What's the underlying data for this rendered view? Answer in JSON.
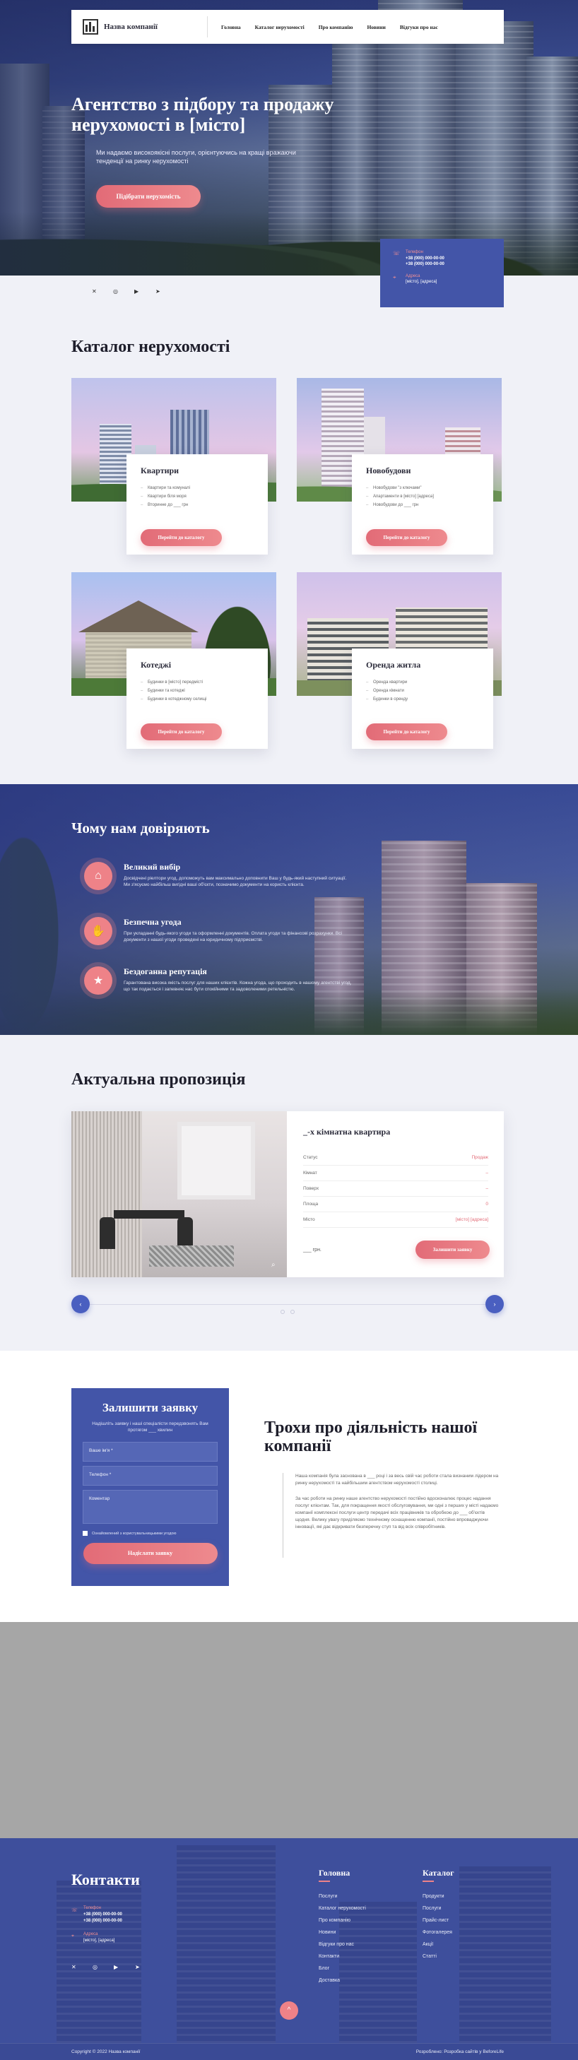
{
  "nav": {
    "brand": "Назва компанії",
    "items": [
      "Головна",
      "Каталог нерухомості",
      "Про компанію",
      "Новини",
      "Відгуки про нас"
    ]
  },
  "hero": {
    "title": "Агентство з підбору та продажу нерухомості в [місто]",
    "subtitle": "Ми надаємо високоякісні послуги, орієнтуючись на кращі вражаючи тенденції на ринку нерухомості",
    "button": "Підібрати нерухомість",
    "phone_label": "Телефон",
    "phone1": "+38 (000) 000-00-00",
    "phone2": "+38 (000) 000-00-00",
    "address_label": "Адреса",
    "address": "[місто], [адреса]"
  },
  "catalog": {
    "title": "Каталог нерухомості",
    "cards": [
      {
        "title": "Квартири",
        "items": [
          "Квартири та комуналі",
          "Квартири біля моря",
          "Вторинне до ___ грн"
        ],
        "button": "Перейти до каталогу"
      },
      {
        "title": "Новобудови",
        "items": [
          "Новобудови \"з ключами\"",
          "Апартаменти в [місто] [адреса]",
          "Новобудови до ___ грн"
        ],
        "button": "Перейти до каталогу"
      },
      {
        "title": "Котеджі",
        "items": [
          "Будинки в [місто] передмісті",
          "Будинки та котеджі",
          "Будинки в котеджному селищі"
        ],
        "button": "Перейти до каталогу"
      },
      {
        "title": "Оренда житла",
        "items": [
          "Оренда квартири",
          "Оренда кімнати",
          "Будинки в оренду"
        ],
        "button": "Перейти до каталогу"
      }
    ]
  },
  "trust": {
    "title": "Чому нам довіряють",
    "items": [
      {
        "icon": "home-icon",
        "title": "Великий вибір",
        "text": "Досвідчені ріелтори угод, допоможуть вам максимально доповнити Ваш у будь-який наступний ситуації. Ми з'ясуємо найбільш вигідні ваші об'єкти, позначимо документи на користь клієнта."
      },
      {
        "icon": "handshake-icon",
        "title": "Безпечна угода",
        "text": "При укладанні будь-якого угоди та оформленні документів. Оплата угоди та фінансові розрахунки. Всі документи з нашої угоди проведені на юридичному підприємстві."
      },
      {
        "icon": "star-icon",
        "title": "Бездоганна репутація",
        "text": "Гарантована висока якість послуг для наших клієнтів. Кожна угода, що проходить в нашому агентстві угод, що так подається і запевняє нас бути спокійними та задоволеними ретельністю."
      }
    ]
  },
  "offer": {
    "title": "Актуальна пропозиція",
    "heading": "_-х кімнатна квартира",
    "rows": [
      {
        "label": "Статус",
        "value": "Продаж"
      },
      {
        "label": "Кімнат",
        "value": "–"
      },
      {
        "label": "Поверх",
        "value": "–"
      },
      {
        "label": "Площа",
        "value": "0"
      },
      {
        "label": "Місто",
        "value": "[місто] [адреса]"
      }
    ],
    "price": "___ грн.",
    "button": "Залишити заявку"
  },
  "form": {
    "title": "Залишити заявку",
    "subtitle": "Надішліть заявку і наші спеціалісти передзвонять Вам протягом ___ хвилин",
    "name_placeholder": "Ваше ім'я *",
    "phone_placeholder": "Телефон *",
    "comment_placeholder": "Коментар",
    "consent": "Ознайомлений з користувальницькими угодою",
    "button": "Надіслати заявку"
  },
  "about": {
    "title": "Трохи про діяльність нашої компанії",
    "p1": "Наша компанія була заснована в ___ році і за весь свій час роботи стала визнаним лідером на ринку нерухомості та найбільшим агентством нерухомості столиці.",
    "p2": "За час роботи на ринку наше агентство нерухомості постійно вдосконалює процес надання послуг клієнтам. Так, для покращення якості обслуговування, ми одні з перших у місті надаємо компанії комплексні послуги центр передачі всіх працівників та обробкою до ___ об'єктів щодня. Велику увагу приділяємо технічному оснащенню компанії, постійно впроваджуючи інновації, які дає відкривати безперечну ступ та від всіх співробітників."
  },
  "footer": {
    "title": "Контакти",
    "phone_label": "Телефон",
    "phone1": "+38 (000) 000-00-00",
    "phone2": "+38 (000) 000-00-00",
    "address_label": "Адреса",
    "address": "[місто], [адреса]",
    "col1_title": "Головна",
    "col1": [
      "Послуги",
      "Каталог нерухомості",
      "Про компанію",
      "Новини",
      "Відгуки про нас",
      "Контакти",
      "Блог",
      "Доставка"
    ],
    "col2_title": "Каталог",
    "col2": [
      "Продукти",
      "Послуги",
      "Прайс-лист",
      "Фотогалерея",
      "Акції",
      "Статті"
    ],
    "copyright": "Copyright © 2022 Назва компанії",
    "credit": "Розроблено: Розробка сайтів у BeforeLife"
  }
}
